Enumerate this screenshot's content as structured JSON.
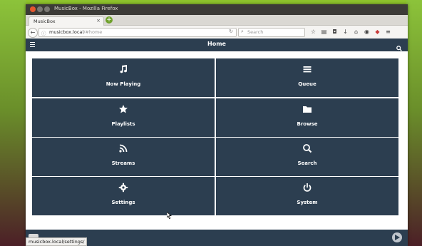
{
  "browser": {
    "window_title": "MusicBox - Mozilla Firefox",
    "tab_label": "MusicBox",
    "tab_close": "×",
    "newtab": "+",
    "back": "←",
    "url_host": "musicbox.local",
    "url_path": "/#home",
    "search_placeholder": "Search",
    "status_url": "musicbox.local/settings/"
  },
  "app": {
    "title": "Home",
    "tiles": [
      {
        "label": "Now Playing",
        "icon": "music-note-icon"
      },
      {
        "label": "Queue",
        "icon": "list-icon"
      },
      {
        "label": "Playlists",
        "icon": "star-icon"
      },
      {
        "label": "Browse",
        "icon": "folder-icon"
      },
      {
        "label": "Streams",
        "icon": "rss-icon"
      },
      {
        "label": "Search",
        "icon": "search-icon"
      },
      {
        "label": "Settings",
        "icon": "gear-icon"
      },
      {
        "label": "System",
        "icon": "power-icon"
      }
    ]
  },
  "colors": {
    "header_bg": "#2c3e50",
    "tile_bg": "#2c3e50"
  }
}
